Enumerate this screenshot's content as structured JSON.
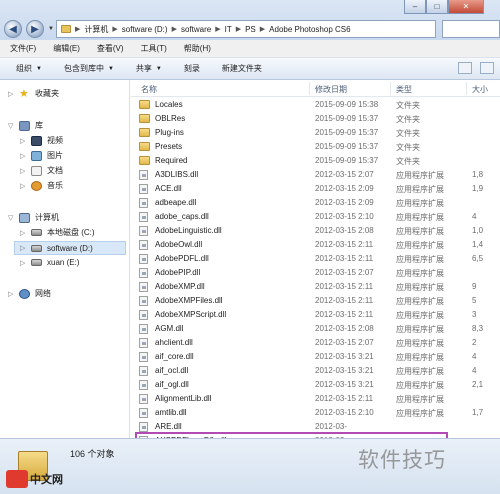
{
  "address": {
    "breadcrumbs": [
      "计算机",
      "software (D:)",
      "software",
      "IT",
      "PS",
      "Adobe Photoshop CS6"
    ]
  },
  "window_controls": {
    "minimize": "–",
    "maximize": "□",
    "close": "✕"
  },
  "menubar": [
    "文件(F)",
    "编辑(E)",
    "查看(V)",
    "工具(T)",
    "帮助(H)"
  ],
  "toolbar": {
    "organize": "组织",
    "include_in_library": "包含到库中",
    "share": "共享",
    "burn": "刻录",
    "new_folder": "新建文件夹"
  },
  "nav": {
    "favorites": "收藏夹",
    "libraries": "库",
    "videos": "视频",
    "pictures": "图片",
    "documents": "文档",
    "music": "音乐",
    "computer": "计算机",
    "local_disk": "本地磁盘 (C:)",
    "software_drive": "software (D:)",
    "xuan_drive": "xuan (E:)",
    "network": "网络"
  },
  "columns": {
    "name": "名称",
    "date": "修改日期",
    "type": "类型",
    "size": "大小"
  },
  "files": [
    {
      "name": "Locales",
      "date": "2015-09-09 15:38",
      "type": "文件夹",
      "size": "",
      "kind": "folder"
    },
    {
      "name": "OBLRes",
      "date": "2015-09-09 15:37",
      "type": "文件夹",
      "size": "",
      "kind": "folder"
    },
    {
      "name": "Plug-ins",
      "date": "2015-09-09 15:37",
      "type": "文件夹",
      "size": "",
      "kind": "folder"
    },
    {
      "name": "Presets",
      "date": "2015-09-09 15:37",
      "type": "文件夹",
      "size": "",
      "kind": "folder"
    },
    {
      "name": "Required",
      "date": "2015-09-09 15:37",
      "type": "文件夹",
      "size": "",
      "kind": "folder"
    },
    {
      "name": "A3DLIBS.dll",
      "date": "2012-03-15 2:07",
      "type": "应用程序扩展",
      "size": "1,8",
      "kind": "dll"
    },
    {
      "name": "ACE.dll",
      "date": "2012-03-15 2:09",
      "type": "应用程序扩展",
      "size": "1,9",
      "kind": "dll"
    },
    {
      "name": "adbeape.dll",
      "date": "2012-03-15 2:09",
      "type": "应用程序扩展",
      "size": "",
      "kind": "dll"
    },
    {
      "name": "adobe_caps.dll",
      "date": "2012-03-15 2:10",
      "type": "应用程序扩展",
      "size": "4",
      "kind": "dll"
    },
    {
      "name": "AdobeLinguistic.dll",
      "date": "2012-03-15 2:08",
      "type": "应用程序扩展",
      "size": "1,0",
      "kind": "dll"
    },
    {
      "name": "AdobeOwl.dll",
      "date": "2012-03-15 2:11",
      "type": "应用程序扩展",
      "size": "1,4",
      "kind": "dll"
    },
    {
      "name": "AdobePDFL.dll",
      "date": "2012-03-15 2:11",
      "type": "应用程序扩展",
      "size": "6,5",
      "kind": "dll"
    },
    {
      "name": "AdobePIP.dll",
      "date": "2012-03-15 2:07",
      "type": "应用程序扩展",
      "size": "",
      "kind": "dll"
    },
    {
      "name": "AdobeXMP.dll",
      "date": "2012-03-15 2:11",
      "type": "应用程序扩展",
      "size": "9",
      "kind": "dll"
    },
    {
      "name": "AdobeXMPFiles.dll",
      "date": "2012-03-15 2:11",
      "type": "应用程序扩展",
      "size": "5",
      "kind": "dll"
    },
    {
      "name": "AdobeXMPScript.dll",
      "date": "2012-03-15 2:11",
      "type": "应用程序扩展",
      "size": "3",
      "kind": "dll"
    },
    {
      "name": "AGM.dll",
      "date": "2012-03-15 2:08",
      "type": "应用程序扩展",
      "size": "8,3",
      "kind": "dll"
    },
    {
      "name": "ahclient.dll",
      "date": "2012-03-15 2:07",
      "type": "应用程序扩展",
      "size": "2",
      "kind": "dll"
    },
    {
      "name": "aif_core.dll",
      "date": "2012-03-15 3:21",
      "type": "应用程序扩展",
      "size": "4",
      "kind": "dll"
    },
    {
      "name": "aif_ocl.dll",
      "date": "2012-03-15 3:21",
      "type": "应用程序扩展",
      "size": "4",
      "kind": "dll"
    },
    {
      "name": "aif_ogl.dll",
      "date": "2012-03-15 3:21",
      "type": "应用程序扩展",
      "size": "2,1",
      "kind": "dll"
    },
    {
      "name": "AlignmentLib.dll",
      "date": "2012-03-15 2:11",
      "type": "应用程序扩展",
      "size": "",
      "kind": "dll"
    },
    {
      "name": "amtlib.dll",
      "date": "2012-03-15 2:10",
      "type": "应用程序扩展",
      "size": "1,7",
      "kind": "dll"
    },
    {
      "name": "ARE.dll",
      "date": "2012-03-",
      "type": "",
      "size": "",
      "kind": "dll"
    },
    {
      "name": "AXSPDFhcseDfh.dll",
      "date": "2012-03-",
      "type": "",
      "size": "",
      "kind": "dll"
    }
  ],
  "status": {
    "count": "106 个对象"
  },
  "watermark": "软件技巧",
  "logo_text": "中文网",
  "colors": {
    "highlight": "#b24bb5",
    "folder": "#e2b84a",
    "selection": "#d9e8f7"
  }
}
